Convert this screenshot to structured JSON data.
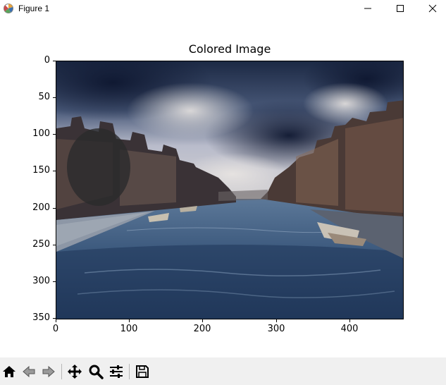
{
  "window": {
    "title": "Figure 1",
    "icon": "matplotlib-icon",
    "controls": [
      "minimize-icon",
      "maximize-icon",
      "close-icon"
    ]
  },
  "figure": {
    "title": "Colored Image",
    "image_description_icon": "canal-photo",
    "y_ticks": [
      "0",
      "50",
      "100",
      "150",
      "200",
      "250",
      "300",
      "350"
    ],
    "x_ticks": [
      "0",
      "100",
      "200",
      "300",
      "400"
    ],
    "x_range": [
      0,
      474
    ],
    "y_range": [
      0,
      352
    ]
  },
  "toolbar": {
    "buttons": [
      "home-icon",
      "back-icon",
      "forward-icon",
      "pan-icon",
      "zoom-icon",
      "configure-subplots-icon",
      "save-icon"
    ]
  }
}
